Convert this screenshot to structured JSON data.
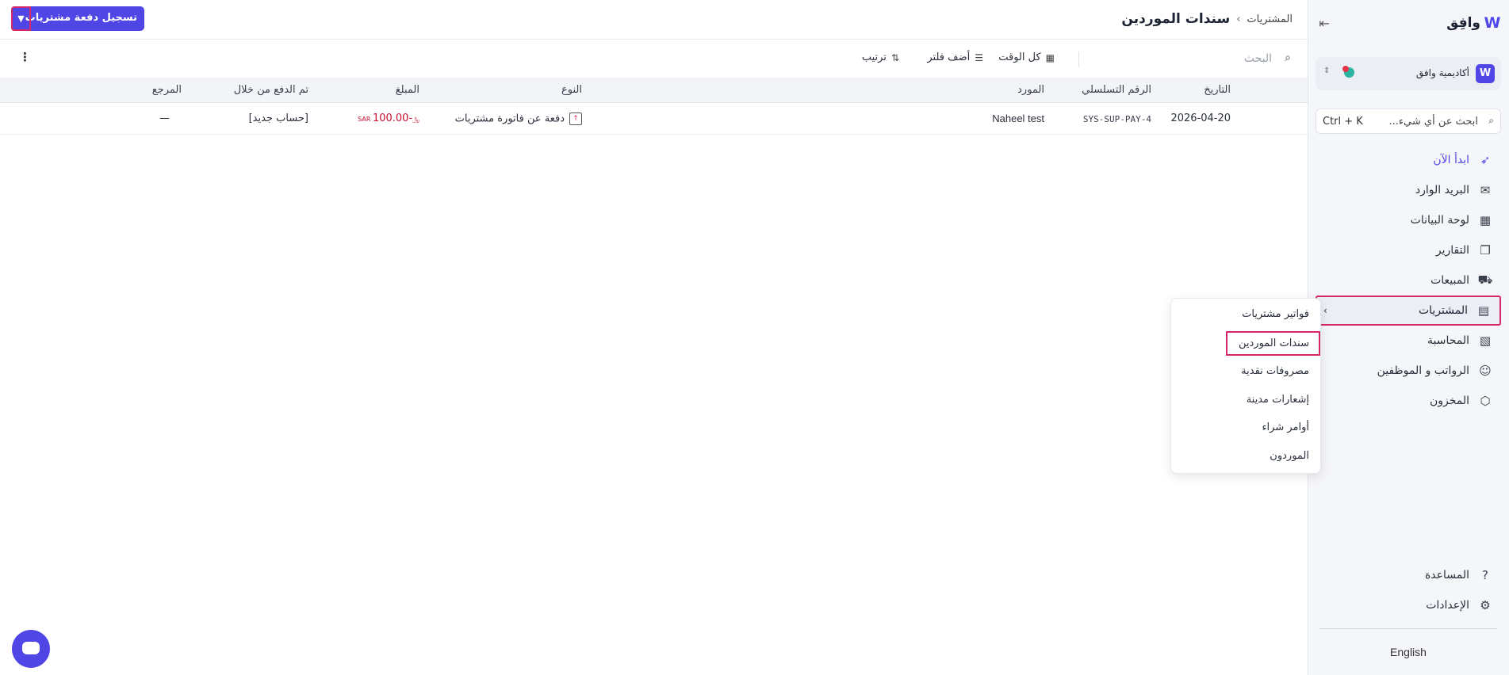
{
  "brand": {
    "logo_text": "وافِق",
    "logo_mark": "W"
  },
  "organization": {
    "name": "أكاديمية وافق",
    "avatar": "W"
  },
  "sidebar_search": {
    "text": "ابحث عن أي شيء...",
    "shortcut": "Ctrl + K"
  },
  "nav": {
    "items": [
      {
        "label": "ابدأ الآن"
      },
      {
        "label": "البريد الوارد"
      },
      {
        "label": "لوحة البيانات"
      },
      {
        "label": "التقارير"
      },
      {
        "label": "المبيعات"
      },
      {
        "label": "المشتريات"
      },
      {
        "label": "المحاسبة"
      },
      {
        "label": "الرواتب و الموظفين"
      },
      {
        "label": "المخزون"
      }
    ],
    "bottom": [
      {
        "label": "المساعدة"
      },
      {
        "label": "الإعدادات"
      }
    ],
    "language": "English"
  },
  "purchases_menu": {
    "items": [
      "فواتير مشتريات",
      "سندات الموردين",
      "مصروفات نقدية",
      "إشعارات مدينة",
      "أوامر شراء",
      "الموردون"
    ]
  },
  "header": {
    "breadcrumb_parent": "المشتريات",
    "breadcrumb_sep": "›",
    "title": "سندات الموردين",
    "primary_button": "تسجيل دفعة مشتريات"
  },
  "toolbar": {
    "search_placeholder": "البحث",
    "time_filter": "كل الوقت",
    "add_filter": "أضف فلتر",
    "sort": "ترتيب"
  },
  "table": {
    "columns": {
      "date": "التاريخ",
      "serial": "الرقم التسلسلي",
      "supplier": "المورد",
      "type": "النوع",
      "amount": "المبلغ",
      "paid_through": "تم الدفع من خلال",
      "reference": "المرجع"
    },
    "rows": [
      {
        "date": "2026-04-20",
        "serial": "SYS-SUP-PAY-4",
        "supplier": "Naheel test",
        "type": "دفعة عن فاتورة مشتريات",
        "amount": "-100.00",
        "currency": "SAR ﷼",
        "paid_through": "[حساب جديد]",
        "reference": "—"
      }
    ]
  },
  "colors": {
    "accent": "#4f46e5",
    "highlight": "#d4286a",
    "negative": "#c8102e"
  }
}
